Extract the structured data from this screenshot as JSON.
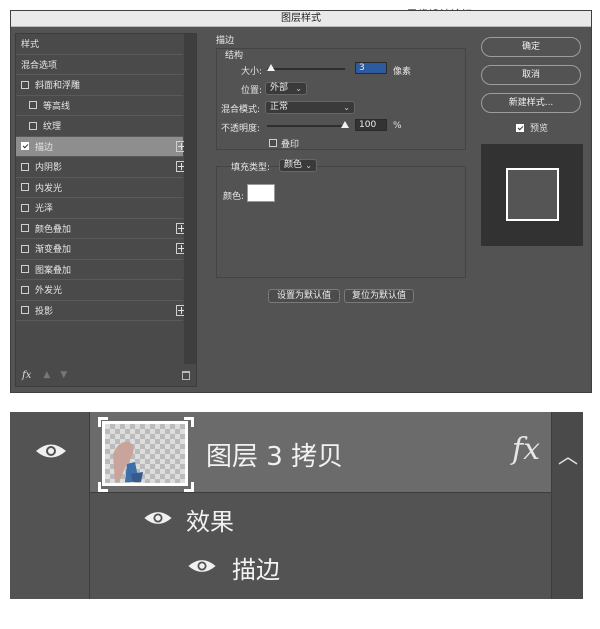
{
  "watermark": "思缘设计论坛 www.MISSYUAN.COM",
  "dialog": {
    "title": "图层样式",
    "left": {
      "items": [
        {
          "label": "样式",
          "checkbox": false,
          "checked": false,
          "plus": false,
          "sub": false,
          "active": false
        },
        {
          "label": "混合选项",
          "checkbox": false,
          "checked": false,
          "plus": false,
          "sub": false,
          "active": false
        },
        {
          "label": "斜面和浮雕",
          "checkbox": true,
          "checked": false,
          "plus": false,
          "sub": false,
          "active": false
        },
        {
          "label": "等高线",
          "checkbox": true,
          "checked": false,
          "plus": false,
          "sub": true,
          "active": false
        },
        {
          "label": "纹理",
          "checkbox": true,
          "checked": false,
          "plus": false,
          "sub": true,
          "active": false
        },
        {
          "label": "描边",
          "checkbox": true,
          "checked": true,
          "plus": true,
          "sub": false,
          "active": true
        },
        {
          "label": "内阴影",
          "checkbox": true,
          "checked": false,
          "plus": true,
          "sub": false,
          "active": false
        },
        {
          "label": "内发光",
          "checkbox": true,
          "checked": false,
          "plus": false,
          "sub": false,
          "active": false
        },
        {
          "label": "光泽",
          "checkbox": true,
          "checked": false,
          "plus": false,
          "sub": false,
          "active": false
        },
        {
          "label": "颜色叠加",
          "checkbox": true,
          "checked": false,
          "plus": true,
          "sub": false,
          "active": false
        },
        {
          "label": "渐变叠加",
          "checkbox": true,
          "checked": false,
          "plus": true,
          "sub": false,
          "active": false
        },
        {
          "label": "图案叠加",
          "checkbox": true,
          "checked": false,
          "plus": false,
          "sub": false,
          "active": false
        },
        {
          "label": "外发光",
          "checkbox": true,
          "checked": false,
          "plus": false,
          "sub": false,
          "active": false
        },
        {
          "label": "投影",
          "checkbox": true,
          "checked": false,
          "plus": true,
          "sub": false,
          "active": false
        }
      ],
      "fx_label": "fx"
    },
    "stroke": {
      "section_title": "描边",
      "structure_title": "结构",
      "size_label": "大小:",
      "size_value": "3",
      "size_unit": "像素",
      "position_label": "位置:",
      "position_value": "外部",
      "blend_label": "混合模式:",
      "blend_value": "正常",
      "opacity_label": "不透明度:",
      "opacity_value": "100",
      "opacity_unit": "%",
      "emboss_label": "叠印",
      "fill_type_label": "填充类型:",
      "fill_type_value": "颜色",
      "color_label": "颜色:",
      "color_value": "#ffffff",
      "set_default": "设置为默认值",
      "reset_default": "复位为默认值"
    },
    "right": {
      "ok": "确定",
      "cancel": "取消",
      "new_style": "新建样式...",
      "preview_label": "预览",
      "preview_checked": true
    }
  },
  "layers_panel": {
    "layer_name": "图层 3 拷贝",
    "fx": "fx",
    "effects_label": "效果",
    "stroke_label": "描边"
  }
}
